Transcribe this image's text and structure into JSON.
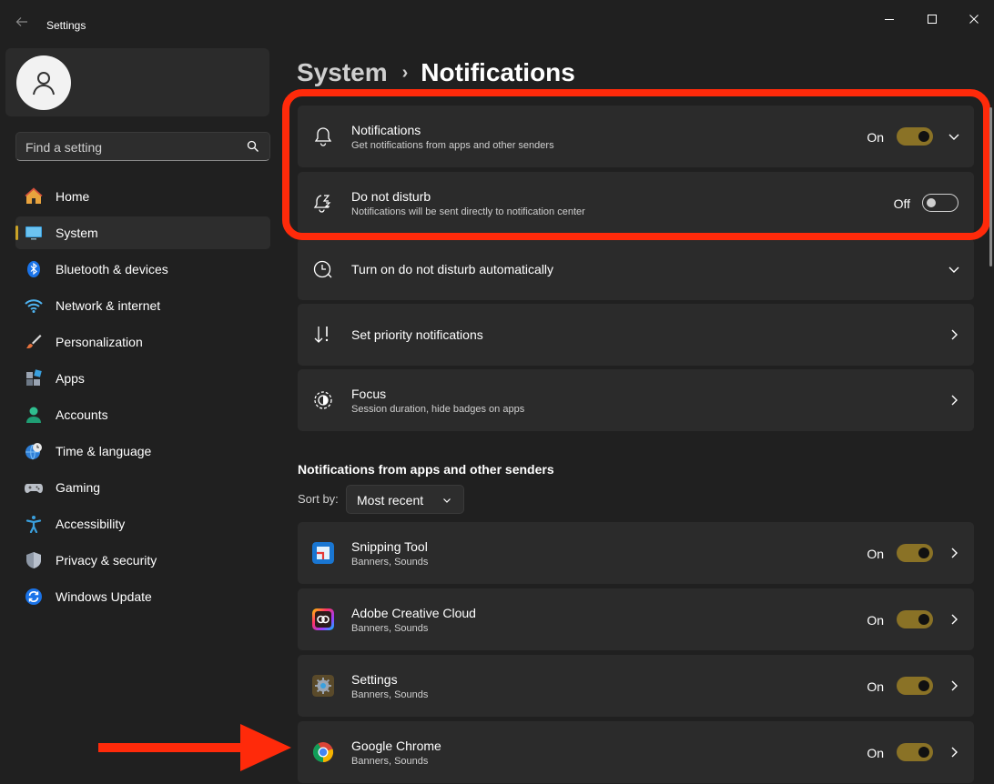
{
  "window": {
    "title": "Settings"
  },
  "search": {
    "placeholder": "Find a setting"
  },
  "sidebar": {
    "items": [
      {
        "label": "Home",
        "icon": "home-icon"
      },
      {
        "label": "System",
        "icon": "system-icon",
        "active": true
      },
      {
        "label": "Bluetooth & devices",
        "icon": "bluetooth-icon"
      },
      {
        "label": "Network & internet",
        "icon": "wifi-icon"
      },
      {
        "label": "Personalization",
        "icon": "brush-icon"
      },
      {
        "label": "Apps",
        "icon": "apps-icon"
      },
      {
        "label": "Accounts",
        "icon": "accounts-icon"
      },
      {
        "label": "Time & language",
        "icon": "clock-globe-icon"
      },
      {
        "label": "Gaming",
        "icon": "gamepad-icon"
      },
      {
        "label": "Accessibility",
        "icon": "accessibility-icon"
      },
      {
        "label": "Privacy & security",
        "icon": "shield-icon"
      },
      {
        "label": "Windows Update",
        "icon": "update-icon"
      }
    ]
  },
  "breadcrumb": {
    "parent": "System",
    "separator": "›",
    "current": "Notifications"
  },
  "settings": {
    "notifications": {
      "title": "Notifications",
      "subtitle": "Get notifications from apps and other senders",
      "state": "On"
    },
    "dnd": {
      "title": "Do not disturb",
      "subtitle": "Notifications will be sent directly to notification center",
      "state": "Off"
    },
    "auto_dnd": {
      "title": "Turn on do not disturb automatically"
    },
    "priority": {
      "title": "Set priority notifications"
    },
    "focus": {
      "title": "Focus",
      "subtitle": "Session duration, hide badges on apps"
    }
  },
  "senders": {
    "section_title": "Notifications from apps and other senders",
    "sort_label": "Sort by:",
    "sort_value": "Most recent",
    "apps": [
      {
        "name": "Snipping Tool",
        "detail": "Banners, Sounds",
        "state": "On",
        "icon": "snipping-tool-icon"
      },
      {
        "name": "Adobe Creative Cloud",
        "detail": "Banners, Sounds",
        "state": "On",
        "icon": "adobe-cc-icon"
      },
      {
        "name": "Settings",
        "detail": "Banners, Sounds",
        "state": "On",
        "icon": "settings-gear-icon"
      },
      {
        "name": "Google Chrome",
        "detail": "Banners, Sounds",
        "state": "On",
        "icon": "chrome-icon"
      }
    ]
  },
  "colors": {
    "background": "#202020",
    "card": "#2b2b2b",
    "accent": "#c9a227",
    "toggle_on": "#8a7226",
    "annotation_red": "#ff2a0a"
  }
}
